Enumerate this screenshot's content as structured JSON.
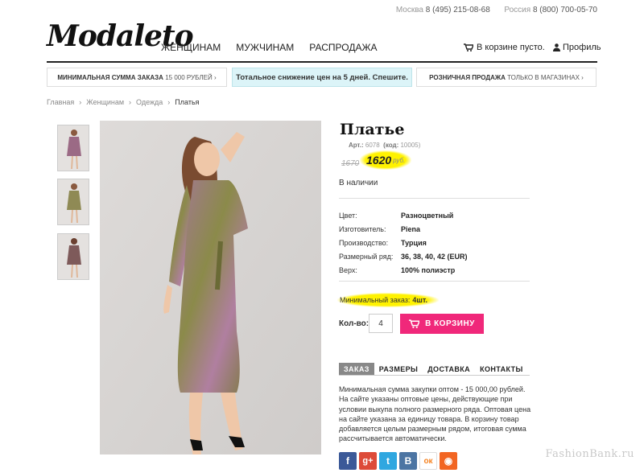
{
  "header": {
    "contacts": [
      {
        "city": "Москва",
        "phone": "8 (495) 215-08-68"
      },
      {
        "city": "Россия",
        "phone": "8 (800) 700-05-70"
      }
    ],
    "logo": "Modaleto",
    "nav": [
      "ЖЕНЩИНАМ",
      "МУЖЧИНАМ",
      "РАСПРОДАЖА"
    ],
    "cart_label": "В корзине пусто.",
    "profile_label": "Профиль"
  },
  "banners": {
    "left_bold": "МИНИМАЛЬНАЯ СУММА ЗАКАЗА",
    "left_rest": "15 000 рублей ›",
    "center": "Тотальное снижение цен на 5 дней. Спешите.",
    "right_bold": "РОЗНИЧНАЯ ПРОДАЖА",
    "right_rest": "ТОЛЬКО В МАГАЗИНАХ ›"
  },
  "breadcrumbs": [
    "Главная",
    "Женщинам",
    "Одежда",
    "Платья"
  ],
  "product": {
    "title": "Платье",
    "art_label": "Арт.:",
    "art_value": "6078",
    "code_label": "(код:",
    "code_value": "10005)",
    "old_price": "1670",
    "price": "1620",
    "currency": "руб.",
    "stock": "В наличии",
    "specs": [
      {
        "key": "Цвет:",
        "value": "Разноцветный"
      },
      {
        "key": "Изготовитель:",
        "value": "Piena"
      },
      {
        "key": "Производство:",
        "value": "Турция"
      },
      {
        "key": "Размерный ряд:",
        "value": "36, 38, 40, 42 (EUR)"
      },
      {
        "key": "Верх:",
        "value": "100% полиэстр"
      }
    ],
    "min_order_label": "Минимальный заказ:",
    "min_order_value": "4шт.",
    "qty_label": "Кол-во:",
    "qty_value": "4",
    "add_to_cart": "В КОРЗИНУ"
  },
  "tabs": [
    "ЗАКАЗ",
    "РАЗМЕРЫ",
    "ДОСТАВКА",
    "КОНТАКТЫ"
  ],
  "tab_text": "Минимальная сумма закупки оптом - 15 000,00 рублей. На сайте указаны оптовые цены, действующие при условии выкупа полного размерного ряда. Оптовая цена на сайте указана за единицу товара. В корзину товар добавляется целым размерным рядом, итоговая сумма рассчитывается автоматически.",
  "social": [
    {
      "name": "facebook",
      "glyph": "f",
      "color": "#3b5998"
    },
    {
      "name": "google-plus",
      "glyph": "g+",
      "color": "#dd4b39"
    },
    {
      "name": "twitter",
      "glyph": "t",
      "color": "#2fa7e0"
    },
    {
      "name": "vkontakte",
      "glyph": "B",
      "color": "#4c75a3"
    },
    {
      "name": "odnoklassniki",
      "glyph": "ок",
      "color": "#ffffff"
    },
    {
      "name": "rss",
      "glyph": "◉",
      "color": "#f26522"
    }
  ],
  "watermark": "FashionBank.ru"
}
